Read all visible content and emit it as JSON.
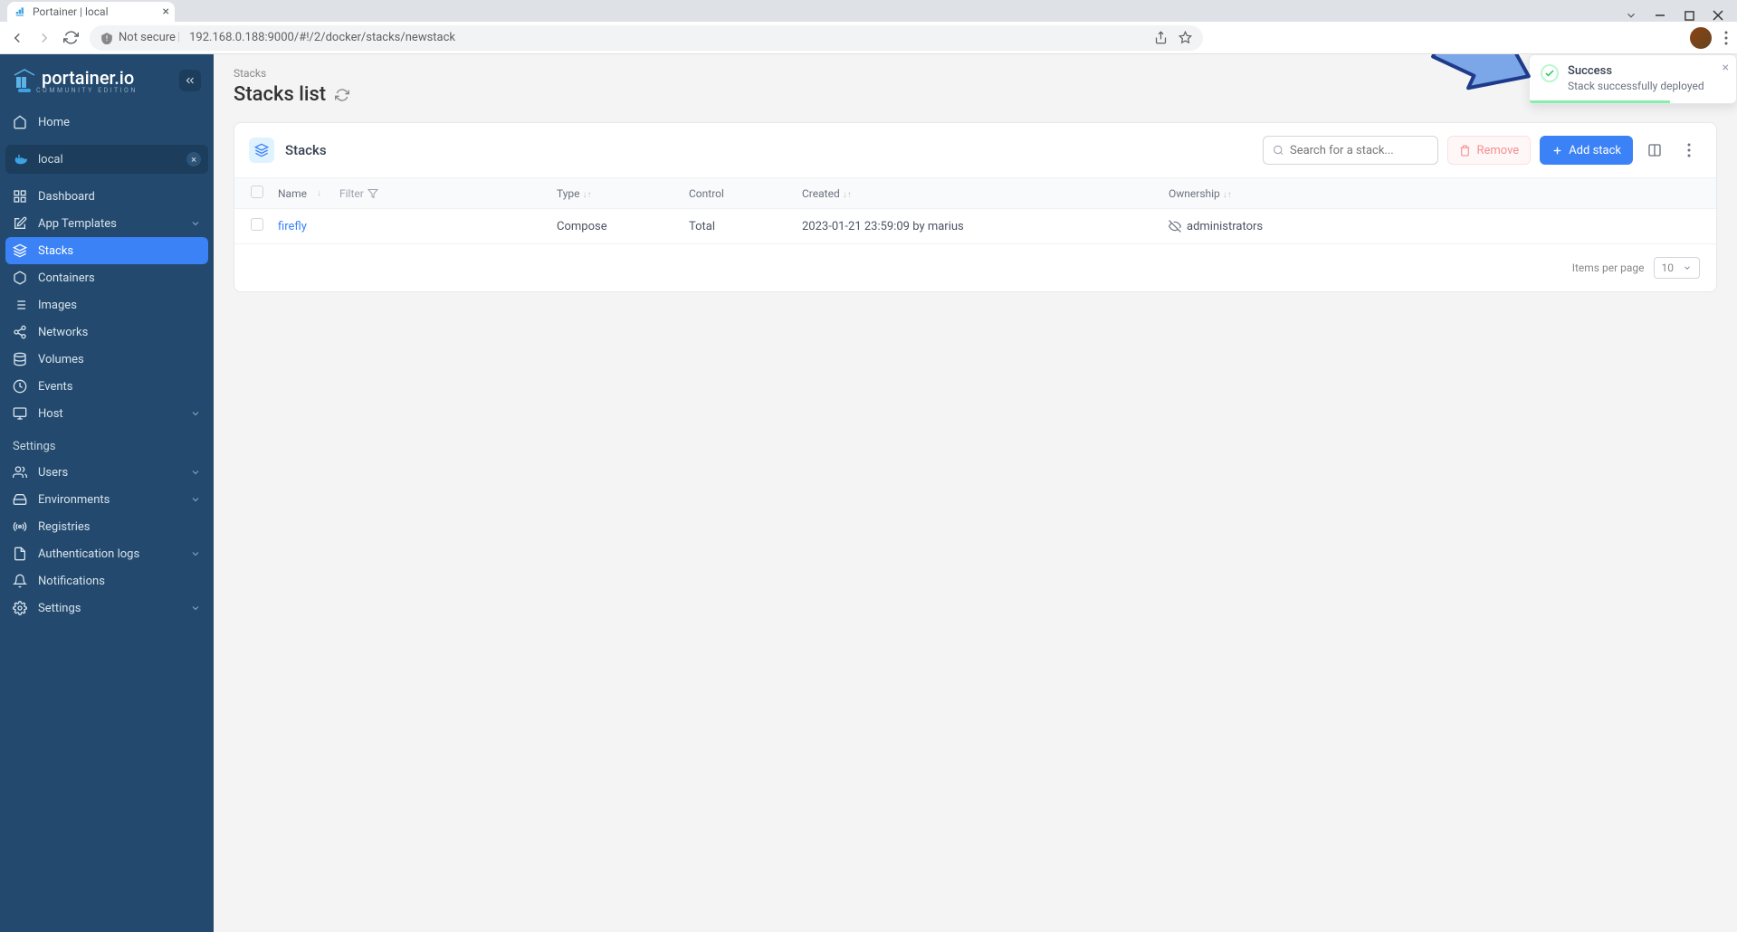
{
  "browser": {
    "tab_title": "Portainer | local",
    "not_secure_label": "Not secure",
    "url": "192.168.0.188:9000/#!/2/docker/stacks/newstack"
  },
  "sidebar": {
    "brand": "portainer.io",
    "brand_sub": "COMMUNITY EDITION",
    "home_label": "Home",
    "env_label": "local",
    "items": [
      {
        "label": "Dashboard"
      },
      {
        "label": "App Templates"
      },
      {
        "label": "Stacks"
      },
      {
        "label": "Containers"
      },
      {
        "label": "Images"
      },
      {
        "label": "Networks"
      },
      {
        "label": "Volumes"
      },
      {
        "label": "Events"
      },
      {
        "label": "Host"
      }
    ],
    "settings_label": "Settings",
    "settings_items": [
      {
        "label": "Users"
      },
      {
        "label": "Environments"
      },
      {
        "label": "Registries"
      },
      {
        "label": "Authentication logs"
      },
      {
        "label": "Notifications"
      },
      {
        "label": "Settings"
      }
    ]
  },
  "page": {
    "breadcrumb": "Stacks",
    "title": "Stacks list"
  },
  "table": {
    "header_title": "Stacks",
    "search_placeholder": "Search for a stack...",
    "remove_label": "Remove",
    "add_label": "Add stack",
    "columns": {
      "name": "Name",
      "filter": "Filter",
      "type": "Type",
      "control": "Control",
      "created": "Created",
      "ownership": "Ownership"
    },
    "rows": [
      {
        "name": "firefly",
        "type": "Compose",
        "control": "Total",
        "created": "2023-01-21 23:59:09 by marius",
        "ownership": "administrators"
      }
    ],
    "items_per_page_label": "Items per page",
    "items_per_page_value": "10"
  },
  "toast": {
    "title": "Success",
    "message": "Stack successfully deployed"
  }
}
